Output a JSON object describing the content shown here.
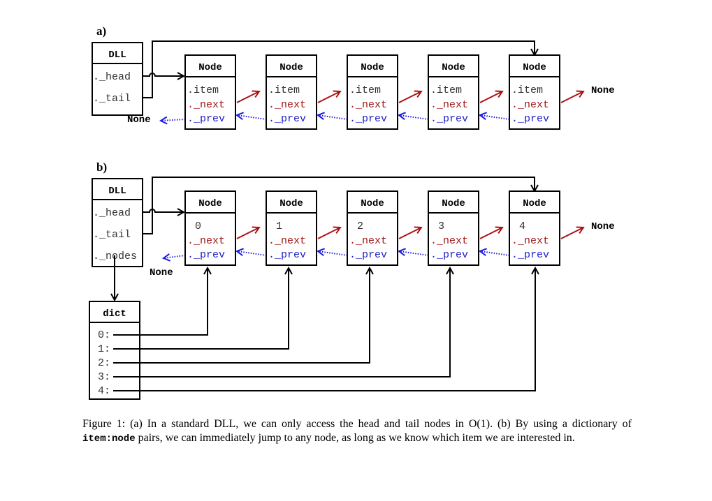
{
  "panel_a": {
    "label": "a)",
    "dll": {
      "title": "DLL",
      "fields": [
        "._head",
        "._tail"
      ]
    },
    "nodes": [
      {
        "title": "Node",
        "item": ".item",
        "next": "._next",
        "prev": "._prev"
      },
      {
        "title": "Node",
        "item": ".item",
        "next": "._next",
        "prev": "._prev"
      },
      {
        "title": "Node",
        "item": ".item",
        "next": "._next",
        "prev": "._prev"
      },
      {
        "title": "Node",
        "item": ".item",
        "next": "._next",
        "prev": "._prev"
      },
      {
        "title": "Node",
        "item": ".item",
        "next": "._next",
        "prev": "._prev"
      }
    ],
    "none_left": "None",
    "none_right": "None"
  },
  "panel_b": {
    "label": "b)",
    "dll": {
      "title": "DLL",
      "fields": [
        "._head",
        "._tail",
        "._nodes"
      ]
    },
    "nodes": [
      {
        "title": "Node",
        "item": "0",
        "next": "._next",
        "prev": "._prev"
      },
      {
        "title": "Node",
        "item": "1",
        "next": "._next",
        "prev": "._prev"
      },
      {
        "title": "Node",
        "item": "2",
        "next": "._next",
        "prev": "._prev"
      },
      {
        "title": "Node",
        "item": "3",
        "next": "._next",
        "prev": "._prev"
      },
      {
        "title": "Node",
        "item": "4",
        "next": "._next",
        "prev": "._prev"
      }
    ],
    "none_left": "None",
    "none_right": "None",
    "dict": {
      "title": "dict",
      "keys": [
        "0:",
        "1:",
        "2:",
        "3:",
        "4:"
      ]
    }
  },
  "caption": {
    "part1": "Figure 1: (a) In a standard DLL, we can only access the head and tail nodes in O(1). (b) By using a dictionary of ",
    "code": "item:node",
    "part2": " pairs, we can immediately jump to any node, as long as we know which item we are interested in."
  },
  "colors": {
    "next_arrow": "#b01010",
    "prev_arrow": "#1a1adf"
  }
}
